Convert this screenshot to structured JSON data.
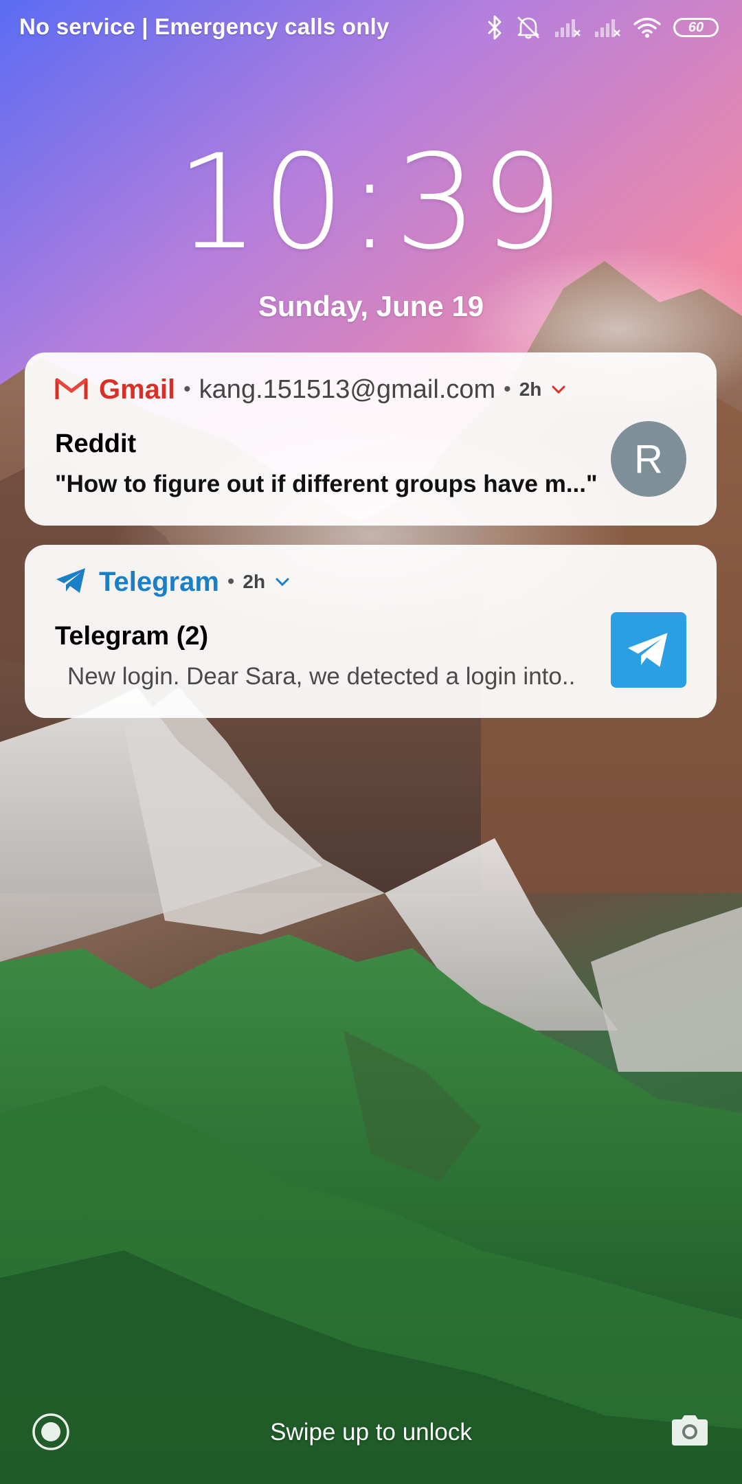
{
  "status_bar": {
    "carrier_text": "No service | Emergency calls only",
    "battery_level": "60",
    "icons": [
      "bluetooth-icon",
      "silent-bell-icon",
      "no-signal-icon",
      "no-signal-icon",
      "wifi-icon",
      "battery-icon"
    ]
  },
  "lockscreen": {
    "time": "10:39",
    "date": "Sunday, June 19",
    "swipe_hint": "Swipe up to unlock"
  },
  "notifications": [
    {
      "app": "Gmail",
      "account": "kang.151513@gmail.com",
      "time": "2h",
      "title": "Reddit",
      "text": "\"How to figure out if different groups have m...\"",
      "avatar_letter": "R",
      "accent": "#d93025"
    },
    {
      "app": "Telegram",
      "time": "2h",
      "title": "Telegram (2)",
      "text": "New login. Dear Sara, we detected a login into..",
      "accent": "#1a7fc6"
    }
  ],
  "colors": {
    "gmail_red": "#d93025",
    "telegram_blue": "#2b9fe3",
    "avatar_gray": "#7f8f97"
  }
}
